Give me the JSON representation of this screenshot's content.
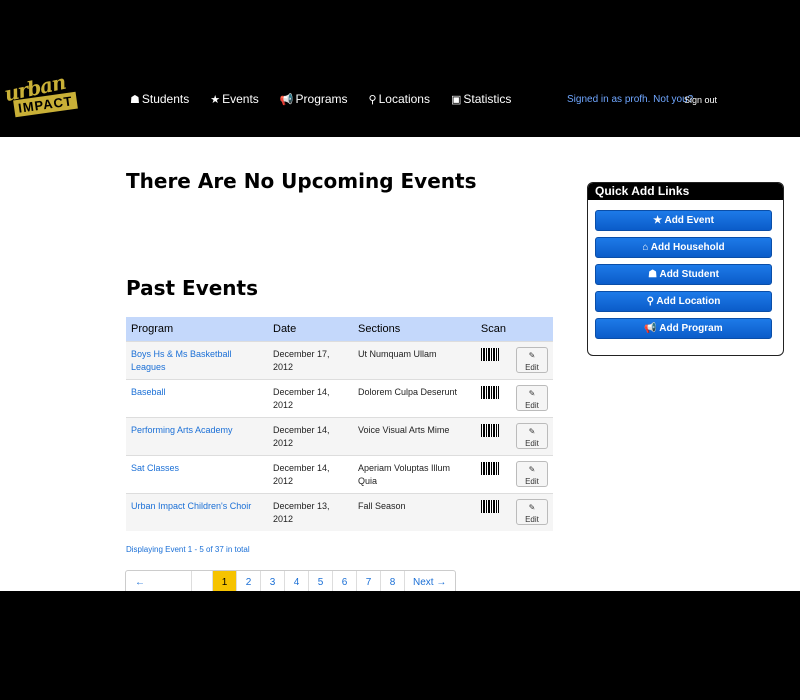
{
  "logo": {
    "line1": "urban",
    "line2": "IMPACT"
  },
  "nav": [
    {
      "icon": "person-icon",
      "glyph": "☗",
      "label": "Students"
    },
    {
      "icon": "star-icon",
      "glyph": "★",
      "label": "Events"
    },
    {
      "icon": "megaphone-icon",
      "glyph": "📢",
      "label": "Programs"
    },
    {
      "icon": "map-marker-icon",
      "glyph": "⚲",
      "label": "Locations"
    },
    {
      "icon": "picture-icon",
      "glyph": "▣",
      "label": "Statistics"
    }
  ],
  "user": {
    "signed_in": "Signed in as profh.  Not you?",
    "sign_out": "Sign out"
  },
  "upcoming": {
    "heading": "There Are No Upcoming Events"
  },
  "past": {
    "heading": "Past Events",
    "columns": [
      "Program",
      "Date",
      "Sections",
      "Scan"
    ],
    "rows": [
      {
        "program": "Boys Hs & Ms Basketball Leagues",
        "date": "December 17, 2012",
        "sections": "Ut Numquam Ullam",
        "edit": "Edit"
      },
      {
        "program": "Baseball",
        "date": "December 14, 2012",
        "sections": "Dolorem  Culpa Deserunt",
        "edit": "Edit"
      },
      {
        "program": "Performing Arts Academy",
        "date": "December 14, 2012",
        "sections": "Voice  Visual Arts  Mime",
        "edit": "Edit"
      },
      {
        "program": "Sat Classes",
        "date": "December 14, 2012",
        "sections": "Aperiam Voluptas Illum Quia",
        "edit": "Edit"
      },
      {
        "program": "Urban Impact Children's Choir",
        "date": "December 13, 2012",
        "sections": "Fall Season",
        "edit": "Edit"
      }
    ],
    "displaying": "Displaying Event 1 - 5 of 37 in total"
  },
  "pagination": {
    "prev": "← Previous",
    "pages": [
      "1",
      "2",
      "3",
      "4",
      "5",
      "6",
      "7",
      "8"
    ],
    "current": "1",
    "next": "Next →"
  },
  "quick_add": {
    "title": "Quick Add Links",
    "buttons": [
      {
        "icon": "star-icon",
        "glyph": "★",
        "label": "Add Event"
      },
      {
        "icon": "home-icon",
        "glyph": "⌂",
        "label": "Add Household"
      },
      {
        "icon": "person-icon",
        "glyph": "☗",
        "label": "Add Student"
      },
      {
        "icon": "map-marker-icon",
        "glyph": "⚲",
        "label": "Add Location"
      },
      {
        "icon": "megaphone-icon",
        "glyph": "📢",
        "label": "Add Program"
      }
    ]
  },
  "colors": {
    "accent": "#0b5cc9",
    "link": "#1a6fd6",
    "table_header": "#c4d8fb",
    "active_page": "#f6c300",
    "logo_gold": "#c9b037"
  }
}
